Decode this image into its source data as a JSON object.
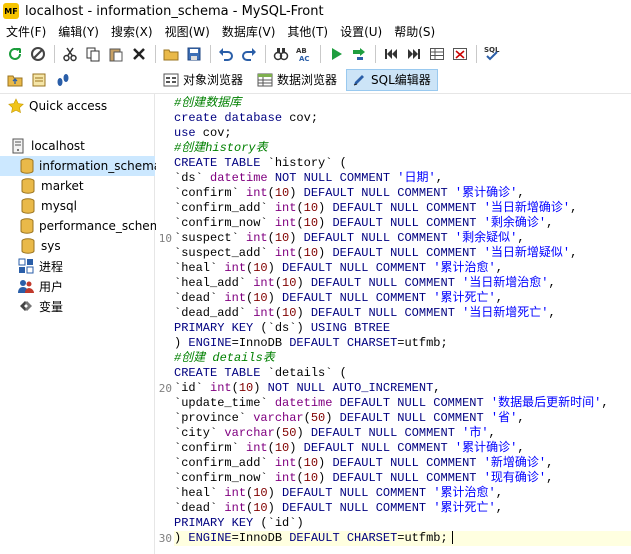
{
  "window": {
    "title": "localhost - information_schema - MySQL-Front",
    "logo": "MF"
  },
  "menu": [
    "文件(F)",
    "编辑(Y)",
    "搜索(X)",
    "视图(W)",
    "数据库(V)",
    "其他(T)",
    "设置(U)",
    "帮助(S)"
  ],
  "toolbar_icons": [
    "refresh-icon",
    "stop-icon",
    "cut-icon",
    "copy-icon",
    "paste-icon",
    "delete-icon",
    "open-folder-icon",
    "save-icon",
    "undo-icon",
    "redo-icon",
    "search-icon",
    "replace-icon",
    "run-icon",
    "run-statement-icon",
    "first-icon",
    "last-icon",
    "grid-icon",
    "clear-icon",
    "sql-format-icon"
  ],
  "viewbar": {
    "tabs": [
      {
        "label": "对象浏览器",
        "icon": "object-browser-icon",
        "active": false
      },
      {
        "label": "数据浏览器",
        "icon": "data-browser-icon",
        "active": false
      },
      {
        "label": "SQL编辑器",
        "icon": "sql-editor-icon",
        "active": true
      }
    ]
  },
  "sidebar": {
    "quick_access": "Quick access",
    "host": "localhost",
    "databases": [
      "information_schema",
      "market",
      "mysql",
      "performance_schema",
      "sys"
    ],
    "selected_database": "information_schema",
    "extras": [
      "进程",
      "用户",
      "变量"
    ]
  },
  "editor": {
    "line_numbers_shown": [
      10,
      20,
      30
    ],
    "current_line": 30,
    "lines": [
      "#创建数据库",
      "create database cov;",
      "use cov;",
      "#创建history表",
      "CREATE TABLE `history` (",
      "`ds` datetime NOT NULL COMMENT '日期',",
      "`confirm` int(10) DEFAULT NULL COMMENT '累计确诊',",
      "`confirm_add` int(10) DEFAULT NULL COMMENT '当日新增确诊',",
      "`confirm_now` int(10) DEFAULT NULL COMMENT '剩余确诊',",
      "`suspect` int(10) DEFAULT NULL COMMENT '剩余疑似',",
      "`suspect_add` int(10) DEFAULT NULL COMMENT '当日新增疑似',",
      "`heal` int(10) DEFAULT NULL COMMENT '累计治愈',",
      "`heal_add` int(10) DEFAULT NULL COMMENT '当日新增治愈',",
      "`dead` int(10) DEFAULT NULL COMMENT '累计死亡',",
      "`dead_add` int(10) DEFAULT NULL COMMENT '当日新增死亡',",
      "PRIMARY KEY (`ds`) USING BTREE",
      ") ENGINE=InnoDB DEFAULT CHARSET=utf8mb4;",
      "#创建 details表",
      "CREATE TABLE `details` (",
      "`id` int(10) NOT NULL AUTO_INCREMENT,",
      "`update_time` datetime DEFAULT NULL COMMENT '数据最后更新时间',",
      "`province` varchar(50) DEFAULT NULL COMMENT '省',",
      "`city` varchar(50) DEFAULT NULL COMMENT '市',",
      "`confirm` int(10) DEFAULT NULL COMMENT '累计确诊',",
      "`confirm_add` int(10) DEFAULT NULL COMMENT '新增确诊',",
      "`confirm_now` int(10) DEFAULT NULL COMMENT '现有确诊',",
      "`heal` int(10) DEFAULT NULL COMMENT '累计治愈',",
      "`dead` int(10) DEFAULT NULL COMMENT '累计死亡',",
      "PRIMARY KEY (`id`)",
      ") ENGINE=InnoDB DEFAULT CHARSET=utf8mb4;"
    ]
  },
  "colors": {
    "accent": "#cce4f7",
    "keyword": "#000080",
    "type": "#800080",
    "string": "#0000ff",
    "comment": "#008000",
    "number": "#800000"
  }
}
